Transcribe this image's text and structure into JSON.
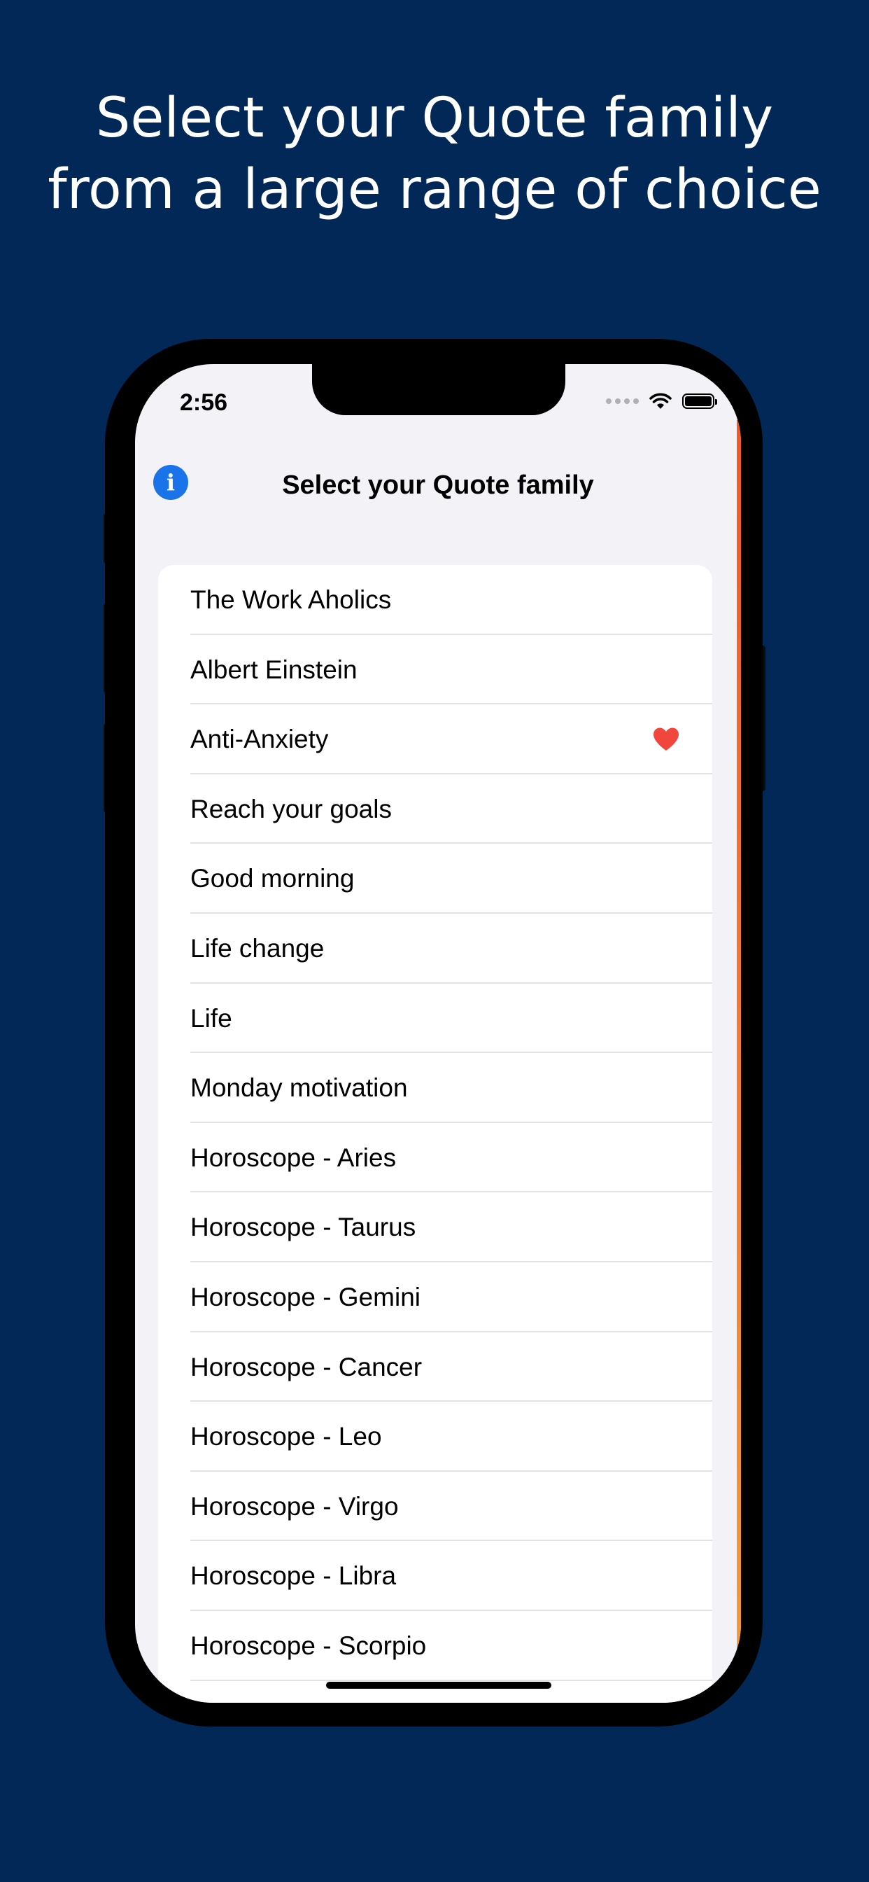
{
  "headline": {
    "line1": "Select your Quote family",
    "line2": "from a large range of choice"
  },
  "status_bar": {
    "time": "2:56"
  },
  "nav": {
    "title": "Select your Quote family",
    "info_icon": "info-icon"
  },
  "colors": {
    "background": "#022858",
    "accent": "#1a73e8",
    "favorite": "#f0463c"
  },
  "list": {
    "items": [
      {
        "label": "The Work Aholics",
        "favorite": false
      },
      {
        "label": "Albert Einstein",
        "favorite": false
      },
      {
        "label": "Anti-Anxiety",
        "favorite": true
      },
      {
        "label": "Reach your goals",
        "favorite": false
      },
      {
        "label": "Good morning",
        "favorite": false
      },
      {
        "label": "Life change",
        "favorite": false
      },
      {
        "label": "Life",
        "favorite": false
      },
      {
        "label": "Monday motivation",
        "favorite": false
      },
      {
        "label": "Horoscope - Aries",
        "favorite": false
      },
      {
        "label": "Horoscope - Taurus",
        "favorite": false
      },
      {
        "label": "Horoscope - Gemini",
        "favorite": false
      },
      {
        "label": "Horoscope - Cancer",
        "favorite": false
      },
      {
        "label": "Horoscope - Leo",
        "favorite": false
      },
      {
        "label": "Horoscope - Virgo",
        "favorite": false
      },
      {
        "label": "Horoscope - Libra",
        "favorite": false
      },
      {
        "label": "Horoscope - Scorpio",
        "favorite": false
      }
    ]
  }
}
